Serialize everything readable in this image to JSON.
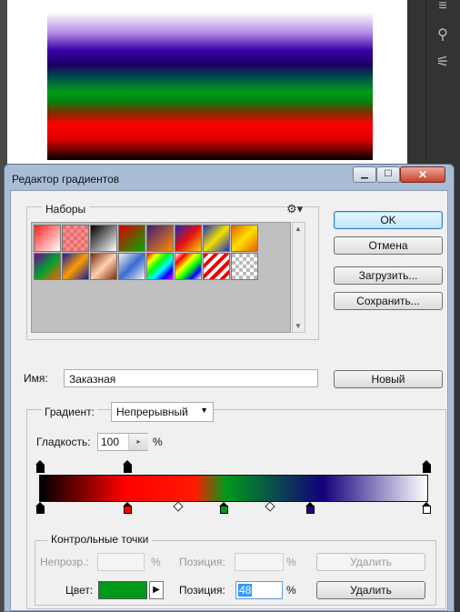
{
  "dialog": {
    "title": "Редактор градиентов",
    "win_min": "▁",
    "win_max": "☐",
    "win_close": "✕"
  },
  "presets": {
    "label": "Наборы",
    "gear": "⚙▾"
  },
  "buttons": {
    "ok": "OK",
    "cancel": "Отмена",
    "load": "Загрузить...",
    "save": "Сохранить...",
    "new": "Новый"
  },
  "name": {
    "label": "Имя:",
    "value": "Заказная"
  },
  "gradient": {
    "type_label": "Градиент:",
    "type_value": "Непрерывный",
    "smoothness_label": "Гладкость:",
    "smoothness_value": "100",
    "percent": "%"
  },
  "stops": {
    "label": "Контрольные точки",
    "opacity_label": "Непрозр.:",
    "opacity_position_label": "Позиция:",
    "delete_label": "Удалить",
    "color_label": "Цвет:",
    "color_value": "#00991a",
    "color_position_label": "Позиция:",
    "color_position_value": "48",
    "percent": "%"
  },
  "colors": {
    "accent": "#3399ff",
    "dialog_frame": "#a9bed6"
  }
}
